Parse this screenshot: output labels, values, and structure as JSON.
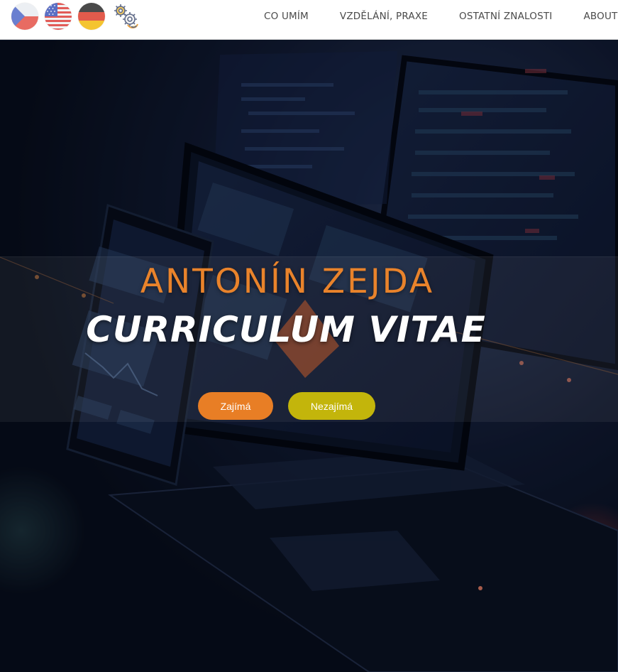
{
  "header": {
    "flags": [
      {
        "name": "czech-flag-icon"
      },
      {
        "name": "us-flag-icon"
      },
      {
        "name": "german-flag-icon"
      },
      {
        "name": "gears-icon"
      }
    ],
    "nav": [
      {
        "label": "CO UMÍM"
      },
      {
        "label": "VZDĚLÁNÍ, PRAXE"
      },
      {
        "label": "OSTATNÍ ZNALOSTI"
      },
      {
        "label": "ABOUT"
      }
    ]
  },
  "hero": {
    "title": "ANTONÍN ZEJDA",
    "subtitle": "CURRICULUM VITAE",
    "buttons": {
      "primary": "Zajímá",
      "secondary": "Nezajímá"
    }
  },
  "colors": {
    "accent_orange": "#e87e25",
    "accent_olive": "#c3b50b",
    "title_orange": "#e9832b",
    "hero_bg": "#0b1424"
  }
}
